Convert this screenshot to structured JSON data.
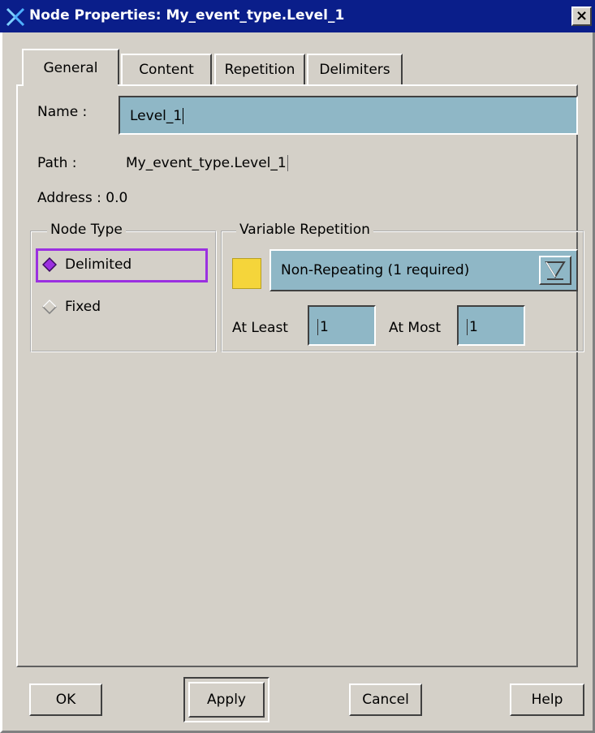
{
  "window": {
    "title": "Node Properties: My_event_type.Level_1",
    "close_glyph": "×",
    "icon": "x-logo-icon",
    "title_bar_color": "#0a1e8a"
  },
  "tabs": [
    {
      "label": "General",
      "active": true
    },
    {
      "label": "Content",
      "active": false
    },
    {
      "label": "Repetition",
      "active": false
    },
    {
      "label": "Delimiters",
      "active": false
    }
  ],
  "general": {
    "name_label": "Name :",
    "name_value": "Level_1",
    "path_label": "Path :",
    "path_value": "My_event_type.Level_1",
    "address_label": "Address :",
    "address_value": "0.0"
  },
  "node_type": {
    "title": "Node Type",
    "options": [
      {
        "label": "Delimited",
        "selected": true
      },
      {
        "label": "Fixed",
        "selected": false
      }
    ],
    "focus_color": "#9b30e0"
  },
  "variable_repetition": {
    "title": "Variable Repetition",
    "swatch_color": "#f5d53a",
    "dropdown_value": "Non-Repeating (1 required)",
    "at_least_label": "At Least",
    "at_least_value": "1",
    "at_most_label": "At Most",
    "at_most_value": "1"
  },
  "buttons": {
    "ok": "OK",
    "apply": "Apply",
    "cancel": "Cancel",
    "help": "Help"
  },
  "field_color": "#8fb7c6"
}
